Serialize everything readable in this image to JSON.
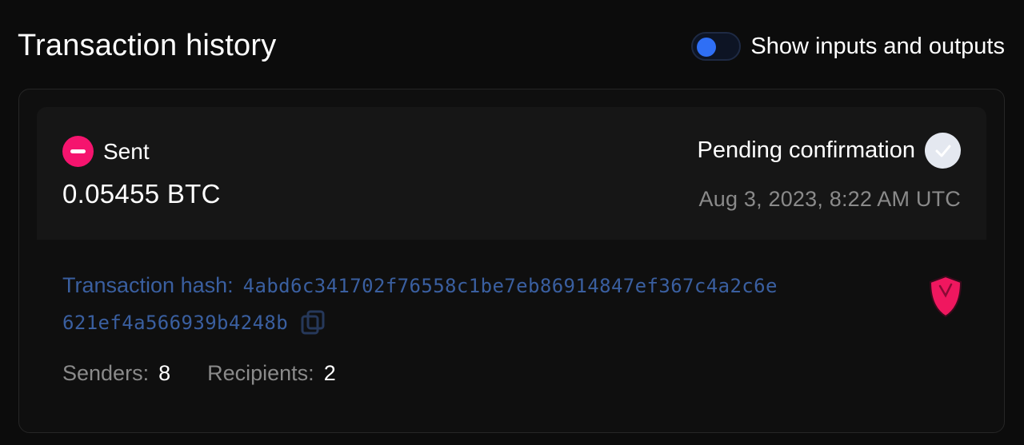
{
  "page": {
    "title": "Transaction history"
  },
  "toggle": {
    "label": "Show inputs and outputs",
    "state": "on",
    "accent": "#2f6ff5"
  },
  "transaction": {
    "type": "Sent",
    "type_icon": "minus-circle-icon",
    "type_color": "#f5146e",
    "amount": "0.05455 BTC",
    "status": "Pending confirmation",
    "status_icon": "check-circle-icon",
    "timestamp": "Aug 3, 2023, 8:22 AM UTC",
    "hash_label": "Transaction hash:",
    "hash_line1": "4abd6c341702f76558c1be7eb86914847ef367c4a2c6e",
    "hash_line2": "621ef4a566939b4248b",
    "hash_color": "#3a5fa0",
    "copy_icon": "copy-icon",
    "risk_icon": "shield-icon",
    "senders_label": "Senders:",
    "senders_count": "8",
    "recipients_label": "Recipients:",
    "recipients_count": "2"
  }
}
